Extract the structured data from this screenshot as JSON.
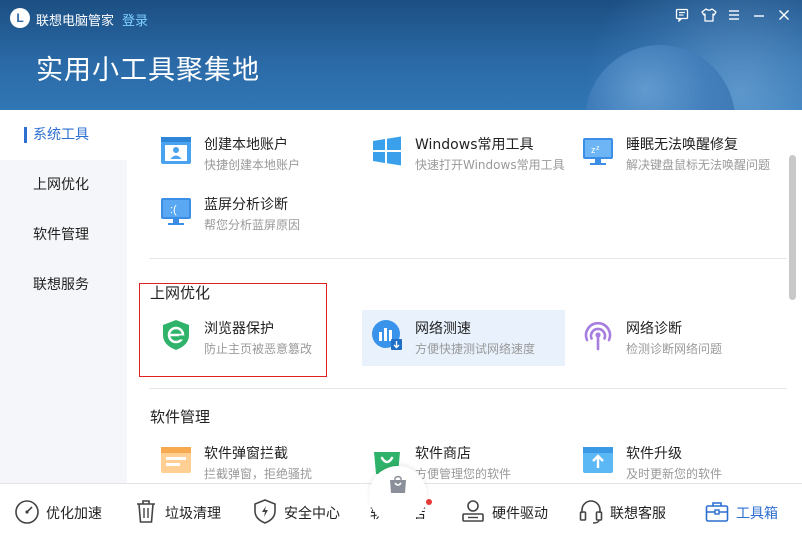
{
  "app": {
    "logo_letter": "L",
    "title": "联想电脑管家",
    "login": "登录"
  },
  "window_controls": [
    "feedback-icon",
    "skin-icon",
    "menu-icon",
    "minimize-icon",
    "close-icon"
  ],
  "page_title": "实用小工具聚集地",
  "sidebar": {
    "items": [
      {
        "label": "系统工具",
        "active": true
      },
      {
        "label": "上网优化",
        "active": false
      },
      {
        "label": "软件管理",
        "active": false
      },
      {
        "label": "联想服务",
        "active": false
      }
    ]
  },
  "system_tools": [
    {
      "title": "创建本地账户",
      "desc": "快捷创建本地账户",
      "icon": "local-account-icon"
    },
    {
      "title": "Windows常用工具",
      "desc": "快速打开Windows常用工具",
      "icon": "windows-icon"
    },
    {
      "title": "睡眠无法唤醒修复",
      "desc": "解决键盘鼠标无法唤醒问题",
      "icon": "sleep-fix-icon"
    },
    {
      "title": "蓝屏分析诊断",
      "desc": "帮您分析蓝屏原因",
      "icon": "bluescreen-icon"
    }
  ],
  "network_section": {
    "title": "上网优化",
    "tools": [
      {
        "title": "浏览器保护",
        "desc": "防止主页被恶意篡改",
        "icon": "browser-shield-icon"
      },
      {
        "title": "网络测速",
        "desc": "方便快捷测试网络速度",
        "icon": "speed-test-icon"
      },
      {
        "title": "网络诊断",
        "desc": "检测诊断网络问题",
        "icon": "network-diagnose-icon"
      }
    ]
  },
  "software_section": {
    "title": "软件管理",
    "tools": [
      {
        "title": "软件弹窗拦截",
        "desc": "拦截弹窗，拒绝骚扰",
        "icon": "popup-block-icon"
      },
      {
        "title": "软件商店",
        "desc": "方便管理您的软件",
        "icon": "software-store-icon"
      },
      {
        "title": "软件升级",
        "desc": "及时更新您的软件",
        "icon": "software-upgrade-icon"
      }
    ]
  },
  "bottom_nav": [
    {
      "label": "优化加速",
      "icon": "speedometer-icon"
    },
    {
      "label": "垃圾清理",
      "icon": "trash-icon"
    },
    {
      "label": "安全中心",
      "icon": "shield-icon"
    },
    {
      "label": "软件商店",
      "icon": "store-bag-icon"
    },
    {
      "label": "硬件驱动",
      "icon": "driver-icon"
    },
    {
      "label": "联想客服",
      "icon": "headset-icon"
    },
    {
      "label": "工具箱",
      "icon": "toolbox-icon",
      "active": true
    }
  ],
  "colors": {
    "accent": "#2c6fd1",
    "header": "#2a69a6",
    "highlight_box": "#e02020"
  }
}
